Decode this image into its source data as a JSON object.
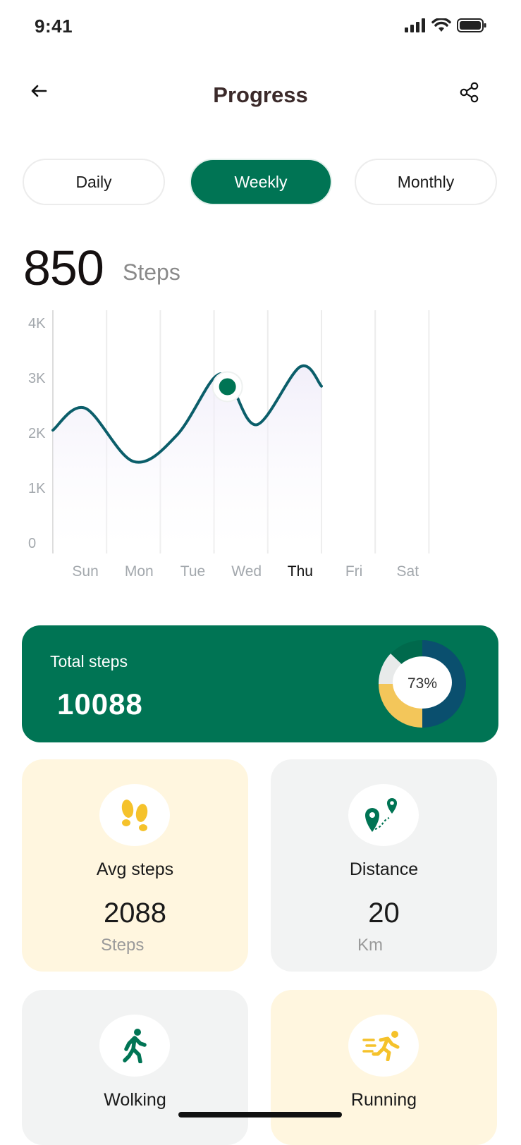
{
  "status_bar": {
    "time": "9:41"
  },
  "header": {
    "title": "Progress"
  },
  "tabs": [
    {
      "label": "Daily",
      "active": false
    },
    {
      "label": "Weekly",
      "active": true
    },
    {
      "label": "Monthly",
      "active": false
    }
  ],
  "summary": {
    "value": "850",
    "unit": "Steps"
  },
  "chart_data": {
    "type": "area",
    "x": [
      "Sun",
      "Mon",
      "Tue",
      "Wed",
      "Thu",
      "Fri",
      "Sat"
    ],
    "y_ticks": [
      "0",
      "1K",
      "2K",
      "3K",
      "4K"
    ],
    "ylim": [
      0,
      4000
    ],
    "highlighted_x": "Thu",
    "curve_points": [
      {
        "day": 0.0,
        "value": 2050
      },
      {
        "day": 0.6,
        "value": 2450
      },
      {
        "day": 1.5,
        "value": 1480
      },
      {
        "day": 2.3,
        "value": 1950
      },
      {
        "day": 3.0,
        "value": 3000
      },
      {
        "day": 3.3,
        "value": 2900
      },
      {
        "day": 3.8,
        "value": 2150
      },
      {
        "day": 4.6,
        "value": 3200
      },
      {
        "day": 5.0,
        "value": 2850
      }
    ],
    "marker": {
      "day": 3.25,
      "value": 2840
    },
    "grid": true
  },
  "total_card": {
    "label": "Total steps",
    "value": "10088",
    "percent_label": "73%",
    "segments": [
      {
        "name": "primary",
        "fraction": 0.5,
        "color": "#0a4f6e"
      },
      {
        "name": "secondary",
        "fraction": 0.25,
        "color": "#f3c65a"
      },
      {
        "name": "tertiary",
        "fraction": 0.25,
        "color": "#e8eaea"
      }
    ]
  },
  "cards": {
    "avg": {
      "label": "Avg steps",
      "value": "2088",
      "unit": "Steps",
      "icon": "footprints-icon"
    },
    "distance": {
      "label": "Distance",
      "value": "20",
      "unit": "Km",
      "icon": "route-pin-icon"
    },
    "walking": {
      "label": "Wolking",
      "icon": "walking-icon"
    },
    "running": {
      "label": "Running",
      "icon": "running-icon"
    }
  },
  "colors": {
    "accent": "#007454",
    "line": "#0b5e6a",
    "highlight_yellow": "#f5c22b",
    "card_yellow": "#fff6df",
    "card_grey": "#f2f3f3"
  }
}
